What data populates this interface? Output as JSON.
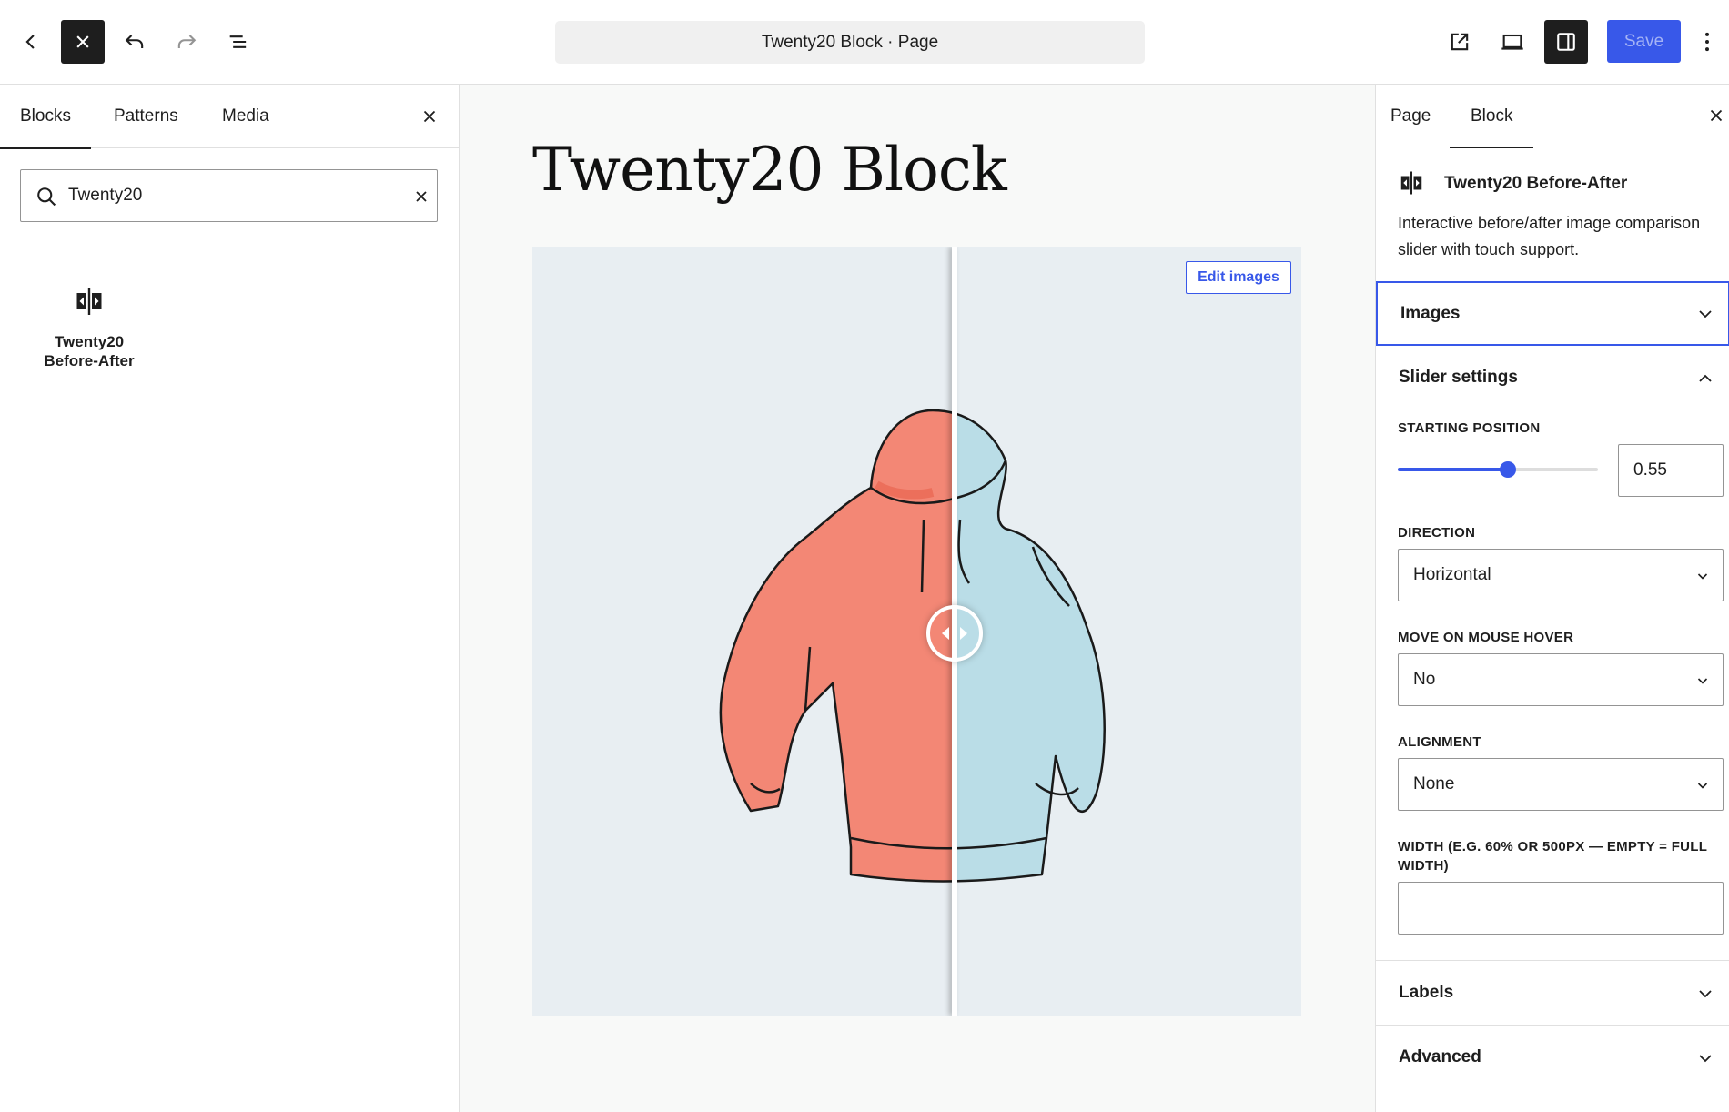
{
  "topbar": {
    "document_title": "Twenty20 Block · Page",
    "save_label": "Save",
    "icons": [
      "back-icon",
      "close-icon",
      "undo-icon",
      "redo-icon",
      "list-view-icon",
      "view-page-icon",
      "device-preview-icon",
      "settings-sidebar-icon",
      "more-options-icon"
    ]
  },
  "inserter": {
    "tabs": [
      {
        "label": "Blocks",
        "active": true
      },
      {
        "label": "Patterns",
        "active": false
      },
      {
        "label": "Media",
        "active": false
      }
    ],
    "search": {
      "value": "Twenty20"
    },
    "results": [
      {
        "label": "Twenty20 Before-After",
        "icon": "before-after-icon"
      }
    ]
  },
  "canvas": {
    "title": "Twenty20 Block",
    "edit_images_label": "Edit images",
    "slider_position": 0.55
  },
  "sidebar": {
    "tabs": [
      {
        "label": "Page",
        "active": false
      },
      {
        "label": "Block",
        "active": true
      }
    ],
    "block_card": {
      "title": "Twenty20 Before-After",
      "description": "Interactive before/after image comparison slider with touch support."
    },
    "panels": {
      "images": {
        "label": "Images",
        "expanded": false
      },
      "slider_settings": {
        "label": "Slider settings",
        "expanded": true,
        "starting_position": {
          "label": "Starting position",
          "value": "0.55",
          "fraction": 0.55
        },
        "direction": {
          "label": "Direction",
          "value": "Horizontal"
        },
        "move_on_hover": {
          "label": "Move on mouse hover",
          "value": "No"
        },
        "alignment": {
          "label": "Alignment",
          "value": "None"
        },
        "width": {
          "label": "Width (e.g. 60% or 500px — empty = full width)",
          "value": ""
        }
      },
      "labels": {
        "label": "Labels",
        "expanded": false
      },
      "advanced": {
        "label": "Advanced",
        "expanded": false
      }
    }
  },
  "colors": {
    "accent": "#3858e9",
    "dark": "#1e1e1e",
    "before_hoodie": "#f47b67",
    "after_hoodie": "#b7dbe6"
  }
}
